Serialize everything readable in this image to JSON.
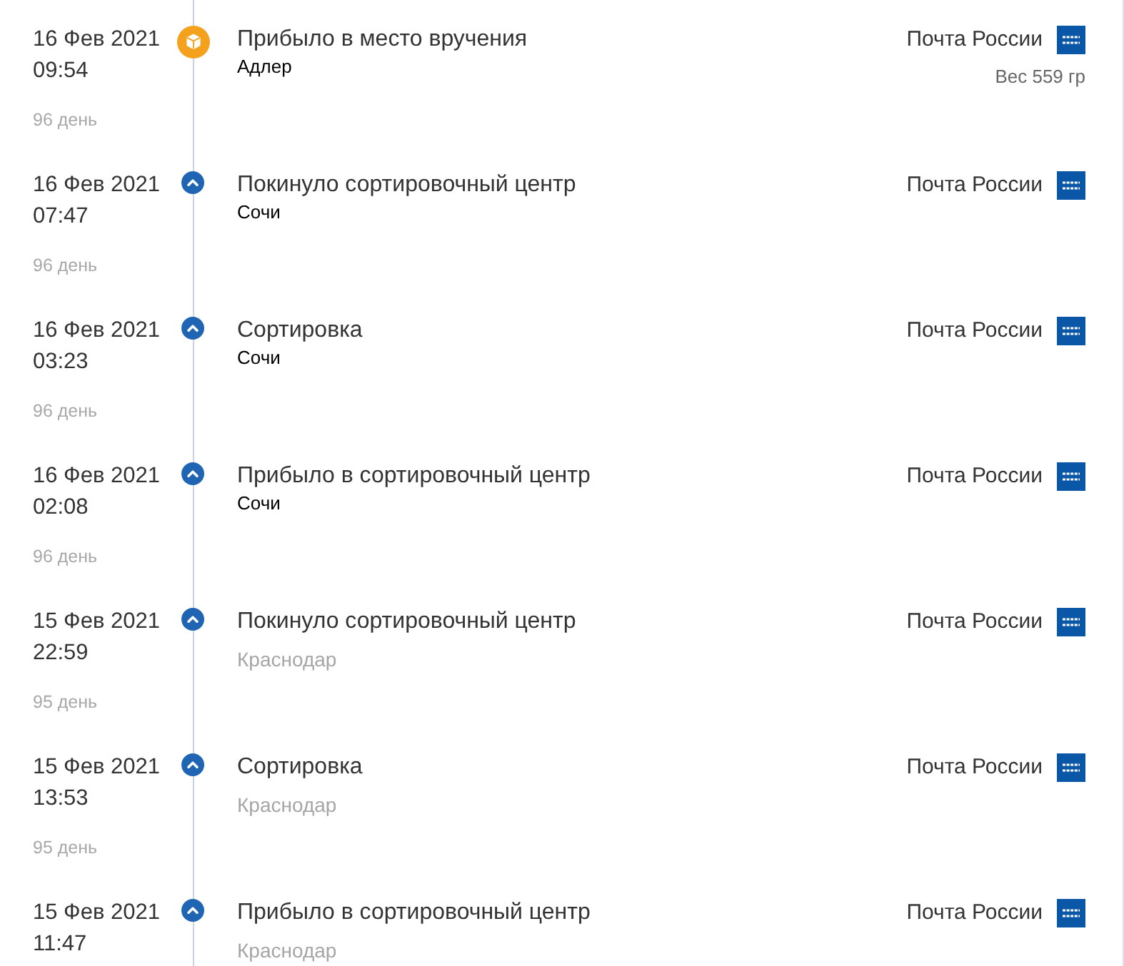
{
  "events": [
    {
      "kind": "final",
      "date": "16 Фев 2021",
      "time": "09:54",
      "day": "96 день",
      "status": "Прибыло в место вручения",
      "location": {
        "text": "Адлер",
        "kind": "inline"
      },
      "carrier": "Почта России",
      "weight": "Вес 559 гр"
    },
    {
      "kind": "step",
      "date": "16 Фев 2021",
      "time": "07:47",
      "day": "96 день",
      "status": "Покинуло сортировочный центр",
      "location": {
        "text": "Сочи",
        "kind": "inline"
      },
      "carrier": "Почта России"
    },
    {
      "kind": "step",
      "date": "16 Фев 2021",
      "time": "03:23",
      "day": "96 день",
      "status": "Сортировка",
      "location": {
        "text": "Сочи",
        "kind": "inline"
      },
      "carrier": "Почта России"
    },
    {
      "kind": "step",
      "date": "16 Фев 2021",
      "time": "02:08",
      "day": "96 день",
      "status": "Прибыло в сортировочный центр",
      "location": {
        "text": "Сочи",
        "kind": "inline"
      },
      "carrier": "Почта России"
    },
    {
      "kind": "step",
      "date": "15 Фев 2021",
      "time": "22:59",
      "day": "95 день",
      "status": "Покинуло сортировочный центр",
      "location": {
        "text": "Краснодар",
        "kind": "muted"
      },
      "carrier": "Почта России"
    },
    {
      "kind": "step",
      "date": "15 Фев 2021",
      "time": "13:53",
      "day": "95 день",
      "status": "Сортировка",
      "location": {
        "text": "Краснодар",
        "kind": "muted"
      },
      "carrier": "Почта России"
    },
    {
      "kind": "step",
      "date": "15 Фев 2021",
      "time": "11:47",
      "status": "Прибыло в сортировочный центр",
      "location": {
        "text": "Краснодар",
        "kind": "muted"
      },
      "carrier": "Почта России"
    }
  ]
}
